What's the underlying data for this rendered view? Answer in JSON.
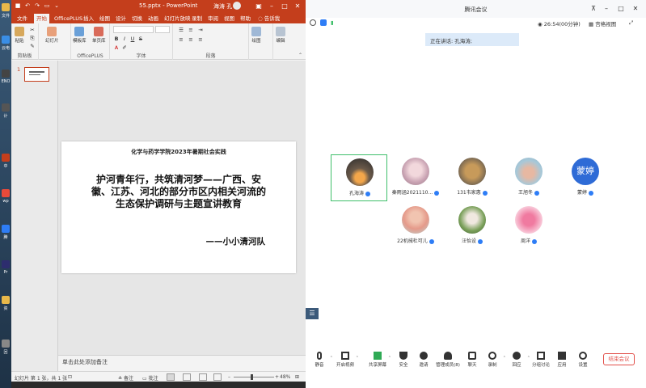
{
  "desktop": {
    "items": [
      {
        "label": "文件",
        "color": "#e8b84a"
      },
      {
        "label": "云电",
        "color": "#3a8ee6"
      },
      {
        "label": "ENO",
        "color": "#444"
      },
      {
        "label": "计",
        "color": "#555"
      },
      {
        "label": "中",
        "color": "#c43e1c"
      },
      {
        "label": "wp",
        "color": "#e84a3a"
      },
      {
        "label": "腾",
        "color": "#2e7df6"
      },
      {
        "label": "Pr",
        "color": "#2d2d6e"
      },
      {
        "label": "资",
        "color": "#e8b84a"
      },
      {
        "label": "回",
        "color": "#888"
      }
    ]
  },
  "ppt": {
    "file_name": "55.pptx - PowerPoint",
    "user_name": "海涛 孔",
    "tabs": [
      "文件",
      "开始",
      "OfficePLUS",
      "插入",
      "绘图",
      "设计",
      "切换",
      "动画",
      "幻灯片放映",
      "录制",
      "审阅",
      "视图",
      "帮助",
      "告诉我"
    ],
    "active_tab": "开始",
    "ribbon": {
      "clipboard": {
        "paste": "粘贴",
        "group": "剪贴板"
      },
      "slides": {
        "new_slide": "幻灯片",
        "group": ""
      },
      "officeplus": {
        "template": "模板库",
        "image": "单页库",
        "group": "OfficePLUS"
      },
      "font": {
        "bold": "B",
        "italic": "I",
        "underline": "U",
        "strike": "S",
        "group": "字体"
      },
      "paragraph": {
        "group": "段落"
      },
      "drawing": {
        "label": "绘图"
      },
      "editing": {
        "label": "编辑"
      }
    },
    "slide_number": "1",
    "slide": {
      "subtitle": "化学与药学学院2023年暑期社会实践",
      "title": "护河青年行，共筑清河梦——广西、安徽、江苏、河北的部分市区内相关河流的生态保护调研与主题宣讲教育",
      "team": "——小小清河队"
    },
    "notes_placeholder": "单击此处添加备注",
    "status": {
      "slide_info": "幻灯片 第 1 张，共 1 张",
      "notes_label": "备注",
      "comments_label": "批注",
      "zoom": "48%"
    }
  },
  "meeting": {
    "app_title": "腾讯会议",
    "timer": "26:54(00分钟)",
    "view_mode": "宫格视图",
    "speaking": "正在讲话: 孔海涛;",
    "participants": [
      {
        "name": "孔海涛",
        "avatar": "photo-sunset"
      },
      {
        "name": "秦雨涵2021110...",
        "avatar": "photo-anime"
      },
      {
        "name": "131韦家惠",
        "avatar": "photo-dog"
      },
      {
        "name": "王旭冬",
        "avatar": "photo-bear"
      },
      {
        "name": "蒙婷",
        "avatar": "text",
        "avatar_text": "蒙婷"
      },
      {
        "name": "22机械杜可儿",
        "avatar": "photo-girl"
      },
      {
        "name": "汪怡设",
        "avatar": "photo-green"
      },
      {
        "name": "周洋",
        "avatar": "photo-pink"
      }
    ],
    "toolbar": [
      "静音",
      "开启视频",
      "共享屏幕",
      "安全",
      "邀请",
      "管理成员(8)",
      "聊天",
      "录制",
      "回应",
      "分组讨论",
      "应用",
      "设置"
    ],
    "end_button": "结束会议",
    "colors": {
      "accent": "#2e7df6",
      "active_border": "#3fbf6a",
      "end": "#e2504a"
    }
  }
}
